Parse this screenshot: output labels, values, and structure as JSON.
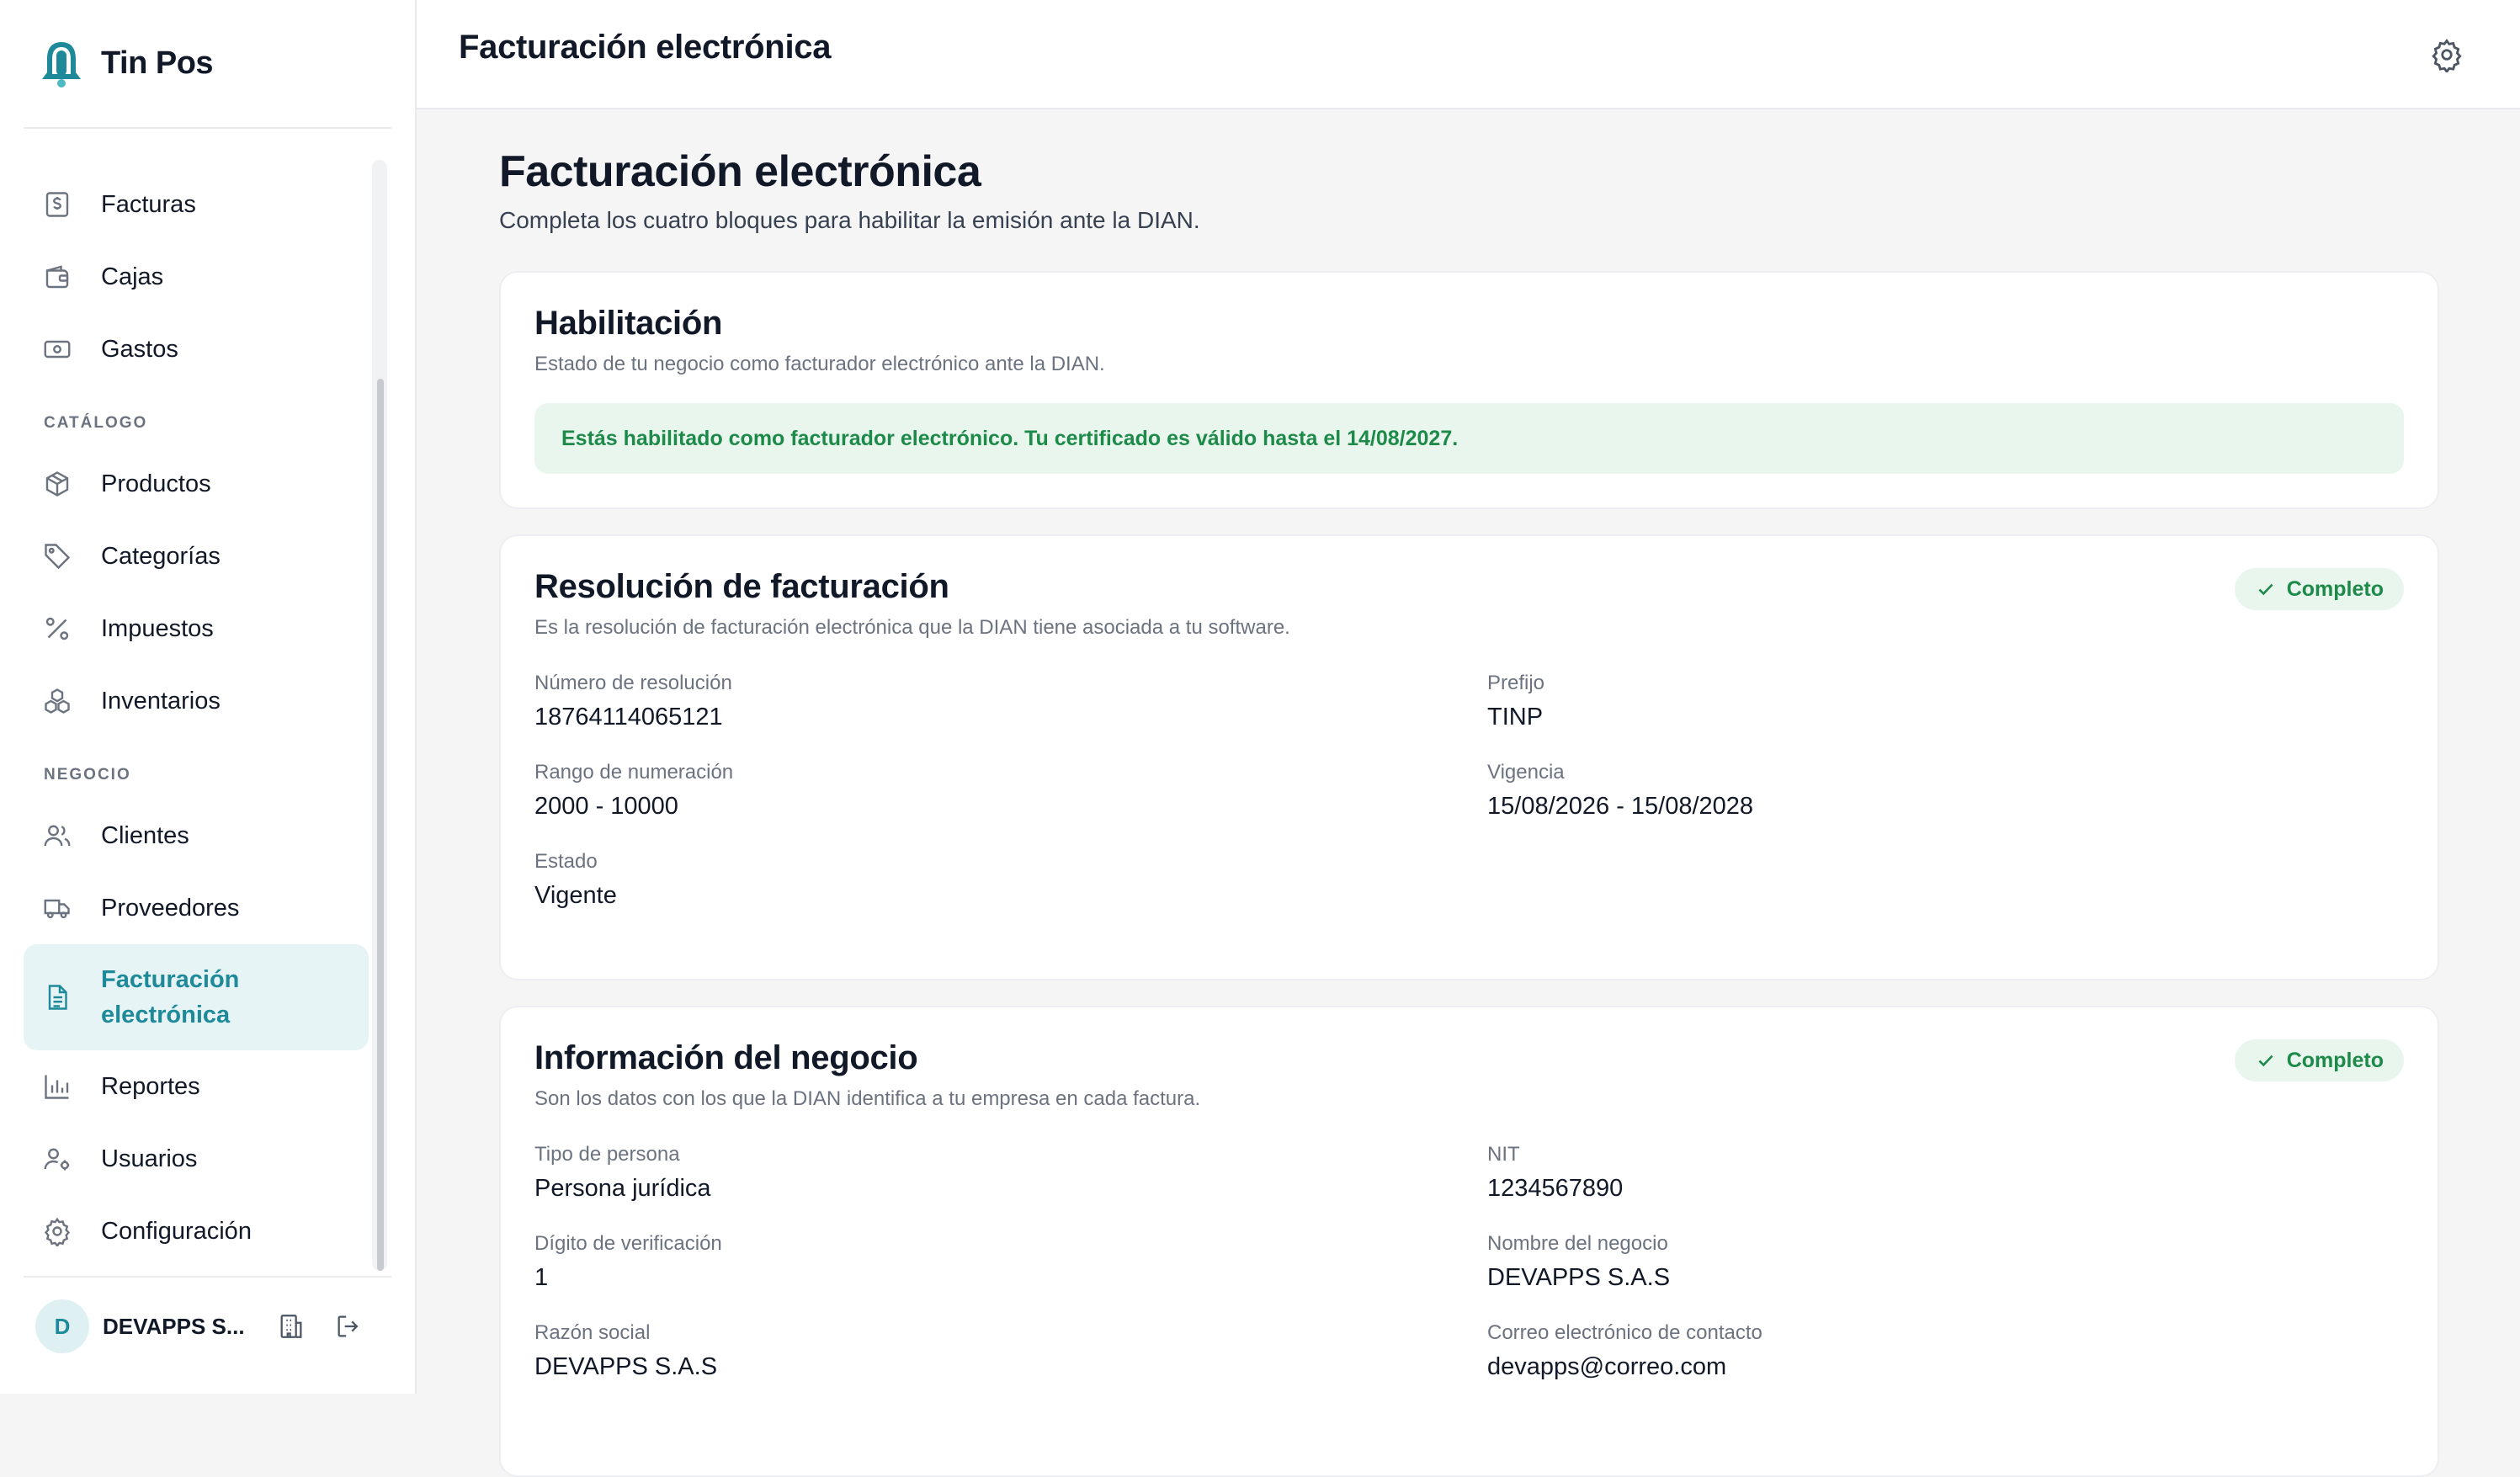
{
  "app": {
    "name": "Tin Pos",
    "brand_color": "#1e8a99"
  },
  "sidebar": {
    "items_top": [
      {
        "label": "Facturas",
        "icon": "dollar-receipt-icon"
      },
      {
        "label": "Cajas",
        "icon": "wallet-icon"
      },
      {
        "label": "Gastos",
        "icon": "banknote-icon"
      }
    ],
    "section_catalog": "CATÁLOGO",
    "items_catalog": [
      {
        "label": "Productos",
        "icon": "box-icon"
      },
      {
        "label": "Categorías",
        "icon": "tag-icon"
      },
      {
        "label": "Impuestos",
        "icon": "percent-icon"
      },
      {
        "label": "Inventarios",
        "icon": "boxes-icon"
      }
    ],
    "section_business": "NEGOCIO",
    "items_business": [
      {
        "label": "Clientes",
        "icon": "users-icon"
      },
      {
        "label": "Proveedores",
        "icon": "truck-icon"
      },
      {
        "label": "Facturación electrónica",
        "icon": "document-icon",
        "active": true
      },
      {
        "label": "Reportes",
        "icon": "bar-chart-icon"
      },
      {
        "label": "Usuarios",
        "icon": "user-cog-icon"
      },
      {
        "label": "Configuración",
        "icon": "gear-icon"
      }
    ],
    "user": {
      "initial": "D",
      "name": "DEVAPPS S..."
    }
  },
  "header": {
    "title": "Facturación electrónica"
  },
  "page": {
    "title": "Facturación electrónica",
    "subtitle": "Completa los cuatro bloques para habilitar la emisión ante la DIAN."
  },
  "habilitacion": {
    "title": "Habilitación",
    "description": "Estado de tu negocio como facturador electrónico ante la DIAN.",
    "alert": "Estás habilitado como facturador electrónico. Tu certificado es válido hasta el 14/08/2027."
  },
  "resolucion": {
    "title": "Resolución de facturación",
    "badge": "Completo",
    "description": "Es la resolución de facturación electrónica que la DIAN tiene asociada a tu software.",
    "fields": {
      "numero_label": "Número de resolución",
      "numero_value": "18764114065121",
      "prefijo_label": "Prefijo",
      "prefijo_value": "TINP",
      "rango_label": "Rango de numeración",
      "rango_value": "2000 - 10000",
      "vigencia_label": "Vigencia",
      "vigencia_value": "15/08/2026 - 15/08/2028",
      "estado_label": "Estado",
      "estado_value": "Vigente"
    }
  },
  "negocio": {
    "title": "Información del negocio",
    "badge": "Completo",
    "description": "Son los datos con los que la DIAN identifica a tu empresa en cada factura.",
    "fields": {
      "tipo_label": "Tipo de persona",
      "tipo_value": "Persona jurídica",
      "nit_label": "NIT",
      "nit_value": "1234567890",
      "digito_label": "Dígito de verificación",
      "digito_value": "1",
      "nombre_label": "Nombre del negocio",
      "nombre_value": "DEVAPPS S.A.S",
      "razon_label": "Razón social",
      "razon_value": "DEVAPPS S.A.S",
      "correo_label": "Correo electrónico de contacto",
      "correo_value": "devapps@correo.com"
    }
  }
}
